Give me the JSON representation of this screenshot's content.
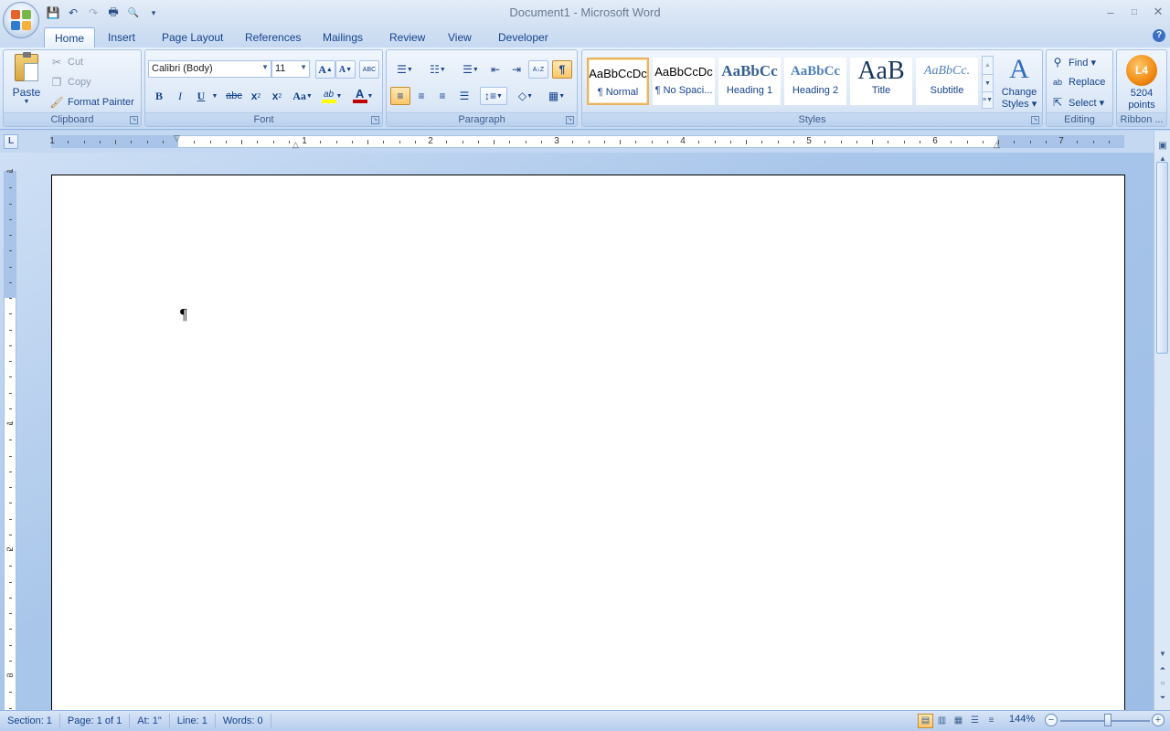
{
  "window": {
    "title": "Document1 - Microsoft Word"
  },
  "qat": {
    "items": [
      {
        "icon": "save-icon",
        "glyph": "💾"
      },
      {
        "icon": "undo-icon",
        "glyph": "↶"
      },
      {
        "icon": "redo-icon",
        "glyph": "↷"
      },
      {
        "icon": "print-icon",
        "glyph": "🖶"
      },
      {
        "icon": "print-preview-icon",
        "glyph": "🔍"
      },
      {
        "icon": "customize-qat-icon",
        "glyph": "▾"
      }
    ]
  },
  "window_controls": {
    "minimize": "–",
    "maximize": "□",
    "close": "✕"
  },
  "tabs": [
    "Home",
    "Insert",
    "Page Layout",
    "References",
    "Mailings",
    "Review",
    "View",
    "Developer"
  ],
  "help_glyph": "?",
  "clipboard": {
    "label": "Clipboard",
    "paste": "Paste",
    "cut": "Cut",
    "copy": "Copy",
    "format_painter": "Format Painter"
  },
  "font": {
    "label": "Font",
    "name": "Calibri (Body)",
    "size": "11",
    "grow_glyph": "A",
    "shrink_glyph": "A",
    "clear_glyph": "ABC",
    "bold": "B",
    "italic": "I",
    "underline": "U",
    "strike": "abc",
    "subscript": "x",
    "superscript": "x",
    "sub_mark": "2",
    "sup_mark": "2",
    "change_case": "Aa",
    "highlight": "ab",
    "font_color": "A",
    "font_color_bar": "#c00000",
    "highlight_bar": "#ffff00"
  },
  "paragraph": {
    "label": "Paragraph",
    "show_marks": "¶",
    "sort": "A↓Z"
  },
  "styles": {
    "label": "Styles",
    "items": [
      {
        "preview": "AaBbCcDc",
        "name": "¶ Normal"
      },
      {
        "preview": "AaBbCcDc",
        "name": "¶ No Spaci..."
      },
      {
        "preview": "AaBbCc",
        "name": "Heading 1"
      },
      {
        "preview": "AaBbCc",
        "name": "Heading 2"
      },
      {
        "preview": "AaB",
        "name": "Title"
      },
      {
        "preview": "AaBbCc.",
        "name": "Subtitle"
      }
    ],
    "change_styles_1": "Change",
    "change_styles_2": "Styles ▾"
  },
  "editing": {
    "label": "Editing",
    "find": "Find ▾",
    "replace": "Replace",
    "select": "Select ▾"
  },
  "ribbon_points": {
    "label": "Ribbon ...",
    "badge": "L4",
    "value_1": "5204",
    "value_2": "points"
  },
  "ruler": {
    "numbers": [
      "1",
      "1",
      "2",
      "3",
      "4",
      "5",
      "6",
      "7"
    ],
    "tab_selector": "L"
  },
  "vruler": {
    "numbers": [
      "1",
      "1",
      "2",
      "3"
    ]
  },
  "document": {
    "paragraph_mark": "¶"
  },
  "status": {
    "section": "Section: 1",
    "page": "Page: 1 of 1",
    "at": "At: 1\"",
    "line": "Line: 1",
    "words": "Words: 0",
    "zoom": "144%"
  }
}
